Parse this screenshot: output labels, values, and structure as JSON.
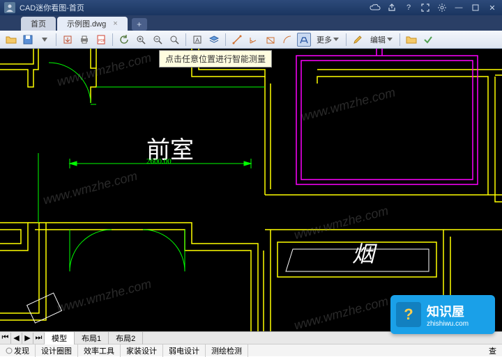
{
  "title_bar": {
    "app_title": "CAD迷你看图-首页"
  },
  "tabs": {
    "items": [
      {
        "label": "首页",
        "active": false
      },
      {
        "label": "示例图.dwg",
        "active": true
      }
    ]
  },
  "toolbar": {
    "more_label": "更多",
    "edit_label": "编辑"
  },
  "canvas": {
    "tooltip_text": "点击任意位置进行智能测量",
    "room_label": "前室",
    "dimension_text": "2600.00",
    "smoke_label": "烟",
    "watermark_text": "www.wmzhe.com"
  },
  "layout_tabs": {
    "items": [
      "模型",
      "布局1",
      "布局2"
    ]
  },
  "status_bar": {
    "items": [
      "发现",
      "设计圈图",
      "效率工具",
      "家装设计",
      "弱电设计",
      "测绘检测"
    ],
    "right_text": "查"
  },
  "brand": {
    "title": "知识屋",
    "url": "zhishiwu.com"
  }
}
